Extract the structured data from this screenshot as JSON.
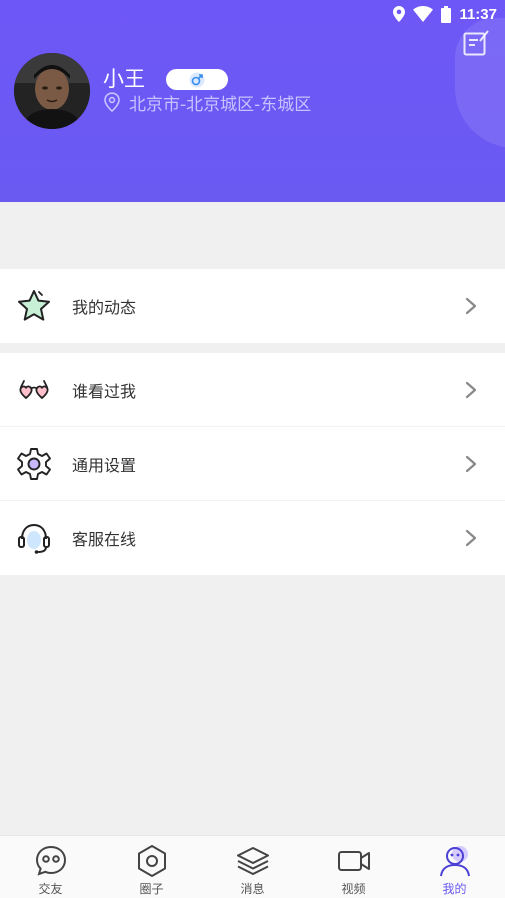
{
  "status_bar": {
    "time": "11:37"
  },
  "profile": {
    "name": "小王",
    "gender_symbol": "♂",
    "location": "北京市-北京城区-东城区"
  },
  "menu": {
    "group1": [
      {
        "label": "我的动态",
        "icon": "star-icon"
      }
    ],
    "group2": [
      {
        "label": "谁看过我",
        "icon": "heart-glasses-icon"
      },
      {
        "label": "通用设置",
        "icon": "gear-icon"
      },
      {
        "label": "客服在线",
        "icon": "headset-icon"
      }
    ]
  },
  "bottom_nav": {
    "items": [
      {
        "label": "交友",
        "icon": "chat-face-icon"
      },
      {
        "label": "圈子",
        "icon": "hexagon-icon"
      },
      {
        "label": "消息",
        "icon": "layers-icon"
      },
      {
        "label": "视频",
        "icon": "video-camera-icon"
      },
      {
        "label": "我的",
        "icon": "profile-icon",
        "active": true
      }
    ]
  },
  "colors": {
    "header_bg": "#6e57f7",
    "accent": "#6a58f2",
    "page_bg": "#f0f0f0",
    "gender_blue": "#3a8ef0"
  }
}
